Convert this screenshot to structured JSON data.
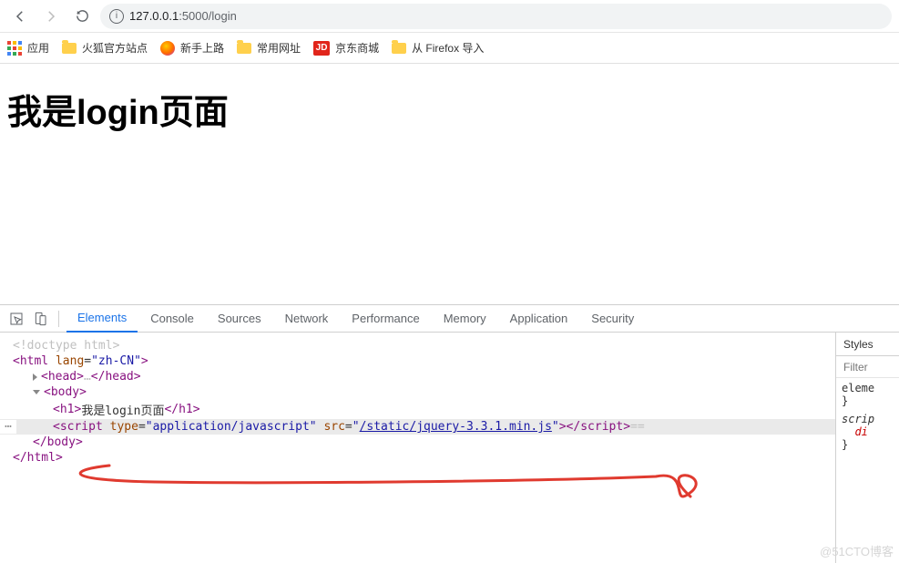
{
  "nav": {
    "url_host": "127.0.0.1",
    "url_path": ":5000/login"
  },
  "bookmarks": {
    "apps": "应用",
    "ff_site": "火狐官方站点",
    "newbie": "新手上路",
    "common": "常用网址",
    "jd": "京东商城",
    "jd_badge": "JD",
    "from_ff": "从 Firefox 导入"
  },
  "page": {
    "h1": "我是login页面"
  },
  "devtabs": {
    "elements": "Elements",
    "console": "Console",
    "sources": "Sources",
    "network": "Network",
    "performance": "Performance",
    "memory": "Memory",
    "application": "Application",
    "security": "Security"
  },
  "dom": {
    "doctype": "<!doctype html>",
    "html_open": "html",
    "lang_attr": "lang",
    "lang_val": "\"zh-CN\"",
    "head_open": "head",
    "head_ellips": "…",
    "head_close": "/head",
    "body_open": "body",
    "body_close": "/body",
    "html_close": "/html",
    "h1_open": "h1",
    "h1_text": "我是login页面",
    "h1_close": "/h1",
    "script_tag": "script",
    "type_attr": "type",
    "type_val": "\"application/javascript\"",
    "src_attr": "src",
    "src_val": "/static/jquery-3.3.1.min.js",
    "script_close": "/script",
    "eqeq": " =="
  },
  "styles": {
    "tab": "Styles",
    "filter": "Filter",
    "sel1": "eleme",
    "brace": "}",
    "sel2": "scrip",
    "prop": "di"
  },
  "watermark": "@51CTO博客"
}
